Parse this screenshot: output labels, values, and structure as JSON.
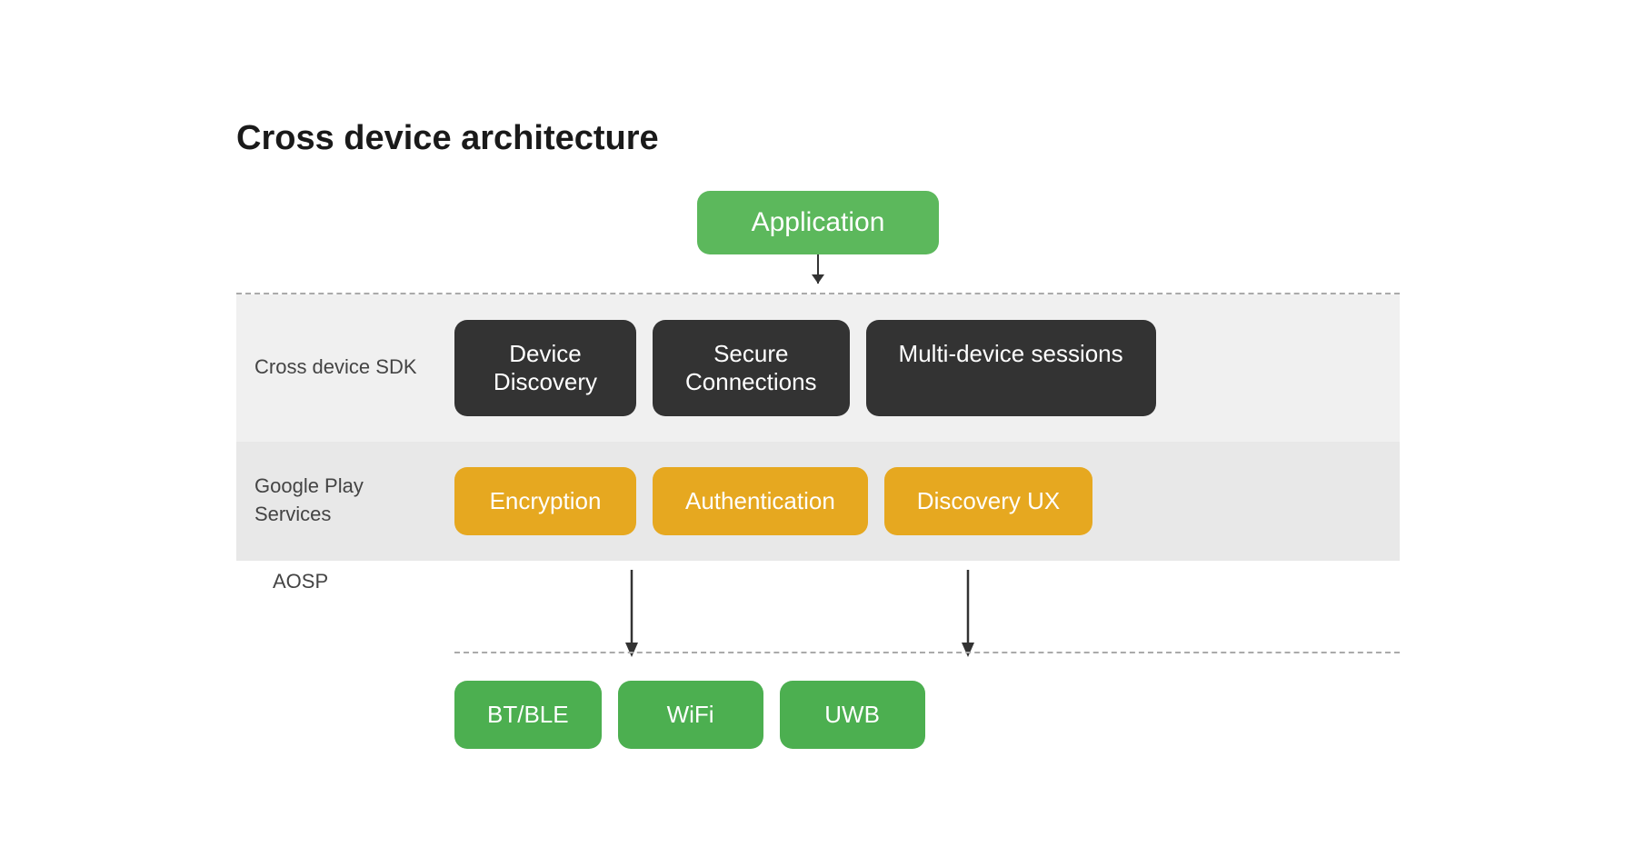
{
  "page": {
    "title": "Cross device architecture",
    "colors": {
      "app_green": "#5cb85c",
      "sdk_dark": "#3a3a3a",
      "gps_yellow": "#e6a820",
      "aosp_green": "#4caf50",
      "arrow": "#333333",
      "bg_sdk": "#efefef",
      "bg_gps": "#e5e5e5",
      "dashed": "#aaaaaa"
    }
  },
  "application": {
    "label": "Application"
  },
  "sdk": {
    "section_label": "Cross device SDK",
    "boxes": [
      {
        "id": "device-discovery",
        "label": "Device\nDiscovery"
      },
      {
        "id": "secure-connections",
        "label": "Secure\nConnections"
      },
      {
        "id": "multi-device-sessions",
        "label": "Multi-device sessions"
      }
    ]
  },
  "gps": {
    "section_label": "Google Play\nServices",
    "boxes": [
      {
        "id": "encryption",
        "label": "Encryption"
      },
      {
        "id": "authentication",
        "label": "Authentication"
      },
      {
        "id": "discovery-ux",
        "label": "Discovery UX"
      }
    ]
  },
  "aosp": {
    "section_label": "AOSP",
    "boxes": [
      {
        "id": "bt-ble",
        "label": "BT/BLE"
      },
      {
        "id": "wifi",
        "label": "WiFi"
      },
      {
        "id": "uwb",
        "label": "UWB"
      }
    ]
  }
}
